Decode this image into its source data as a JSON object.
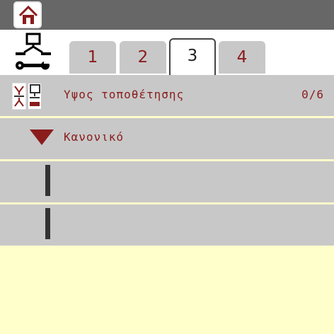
{
  "colors": {
    "topbar": "#676767",
    "accent": "#8a1c1c",
    "row_bg": "#c8c8c8",
    "page_bg": "#ffffcc",
    "tab_inactive": "#c8c8c8"
  },
  "icons": {
    "home": "home-icon",
    "service": "service-person-wrench-icon",
    "height": "mounting-height-icon",
    "dropdown": "triangle-down-icon"
  },
  "tabs": [
    {
      "label": "1"
    },
    {
      "label": "2"
    },
    {
      "label": "3",
      "active": true
    },
    {
      "label": "4"
    }
  ],
  "rows": {
    "mounting_height": {
      "label": "Υψος τοποθέτησης",
      "value": "0/6"
    },
    "mode": {
      "label": "Κανονικό"
    }
  }
}
